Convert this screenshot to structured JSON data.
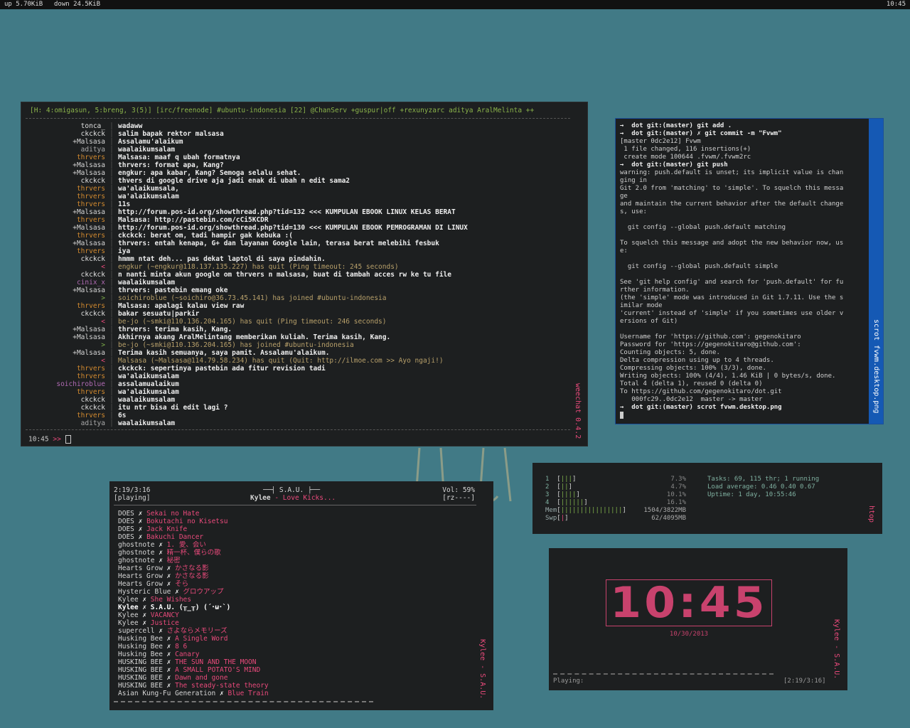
{
  "topbar": {
    "up": "up 5.70KiB",
    "down": "down 24.5KiB",
    "time": "10:45"
  },
  "weechat": {
    "title": "weechat 0.4.2",
    "topic": "[H: 4:omigasun, 5:breng, 3(5)] [irc/freenode] #ubuntu-indonesia [22] @ChanServ +guspur|off +rexunyzarc  aditya  AralMelinta ++",
    "lines": [
      {
        "nick": "tonca_",
        "nc": "#e0e0e0",
        "msg": "wadaww"
      },
      {
        "nick": "ckckck",
        "nc": "#e0e0e0",
        "msg": "salim bapak rektor malsasa"
      },
      {
        "nick": "+Malsasa",
        "nc": "#d6d6d6",
        "msg": "Assalamu'alaikum"
      },
      {
        "nick": "aditya",
        "nc": "#aaaaaa",
        "msg": "waalaikumsalam"
      },
      {
        "nick": "thrvers",
        "nc": "#d28a2f",
        "msg": "Malsasa: maaf q ubah formatnya"
      },
      {
        "nick": "+Malsasa",
        "nc": "#d6d6d6",
        "msg": "thrvers: format apa, Kang?"
      },
      {
        "nick": "+Malsasa",
        "nc": "#d6d6d6",
        "msg": "engkur: apa kabar, Kang? Semoga selalu sehat."
      },
      {
        "nick": "ckckck",
        "nc": "#e0e0e0",
        "msg": "thvers di google drive aja jadi enak di ubah n edit sama2"
      },
      {
        "nick": "thrvers",
        "nc": "#d28a2f",
        "msg": "wa'alaikumsala,"
      },
      {
        "nick": "thrvers",
        "nc": "#d28a2f",
        "msg": "wa'alaikumsalam"
      },
      {
        "nick": "thrvers",
        "nc": "#d28a2f",
        "msg": "11s"
      },
      {
        "nick": "+Malsasa",
        "nc": "#d6d6d6",
        "msg": "http://forum.pos-id.org/showthread.php?tid=132   <<<   KUMPULAN EBOOK LINUX KELAS BERAT"
      },
      {
        "nick": "thrvers",
        "nc": "#d28a2f",
        "msg": "Malsasa: http://pastebin.com/cCi5KCDR"
      },
      {
        "nick": "+Malsasa",
        "nc": "#d6d6d6",
        "msg": "http://forum.pos-id.org/showthread.php?tid=130   <<<   KUMPULAN EBOOK PEMROGRAMAN DI LINUX"
      },
      {
        "nick": "thrvers",
        "nc": "#d28a2f",
        "msg": "ckckck: berat om, tadi hampir gak kebuka :("
      },
      {
        "nick": "+Malsasa",
        "nc": "#d6d6d6",
        "msg": "thrvers: entah kenapa, G+ dan layanan Google lain, terasa berat melebihi fesbuk"
      },
      {
        "nick": "thrvers",
        "nc": "#d28a2f",
        "msg": "iya"
      },
      {
        "nick": "ckckck",
        "nc": "#e0e0e0",
        "msg": "hmmm ntat deh... pas dekat laptol di saya pindahin."
      },
      {
        "nick": "<",
        "nc": "#e94a7b",
        "msg": "engkur (~engkur@118.137.135.227) has quit (Ping timeout: 245 seconds)",
        "sys": "quit"
      },
      {
        "nick": "ckckck",
        "nc": "#e0e0e0",
        "msg": "n nanti minta akun google om thrvers n malsasa, buat di tambah acces rw ke tu file"
      },
      {
        "nick": "cinix_x",
        "nc": "#b06ab3",
        "msg": "waalaikumsalam"
      },
      {
        "nick": "+Malsasa",
        "nc": "#d6d6d6",
        "msg": "thrvers: pastebin emang oke"
      },
      {
        "nick": ">",
        "nc": "#7fb04a",
        "msg": "soichiroblue (~soichiro@36.73.45.141) has joined #ubuntu-indonesia",
        "sys": "join"
      },
      {
        "nick": "thrvers",
        "nc": "#d28a2f",
        "msg": "Malsasa: apalagi kalau view raw"
      },
      {
        "nick": "ckckck",
        "nc": "#e0e0e0",
        "msg": "bakar sesuatu|parkir"
      },
      {
        "nick": "<",
        "nc": "#e94a7b",
        "msg": "be-jo (~smki@110.136.204.165) has quit (Ping timeout: 246 seconds)",
        "sys": "quit"
      },
      {
        "nick": "+Malsasa",
        "nc": "#d6d6d6",
        "msg": "thrvers: terima kasih, Kang."
      },
      {
        "nick": "+Malsasa",
        "nc": "#d6d6d6",
        "msg": "Akhirnya akang AralMelintang memberikan kuliah. Terima kasih, Kang."
      },
      {
        "nick": ">",
        "nc": "#7fb04a",
        "msg": "be-jo (~smki@110.136.204.165) has joined #ubuntu-indonesia",
        "sys": "join"
      },
      {
        "nick": "+Malsasa",
        "nc": "#d6d6d6",
        "msg": "Terima kasih semuanya, saya pamit. Assalamu'alaikum."
      },
      {
        "nick": "<",
        "nc": "#e94a7b",
        "msg": "Malsasa (~Malsasa@114.79.58.234) has quit (Quit: http://ilmoe.com  >>  Ayo ngaji!)",
        "sys": "quit"
      },
      {
        "nick": "thrvers",
        "nc": "#d28a2f",
        "msg": "ckckck: sepertinya pastebin ada fitur revision tadi"
      },
      {
        "nick": "thrvers",
        "nc": "#d28a2f",
        "msg": "wa'alaikumsalam"
      },
      {
        "nick": "soichiroblue",
        "nc": "#b06ab3",
        "msg": "assalamualaikum"
      },
      {
        "nick": "thrvers",
        "nc": "#d28a2f",
        "msg": "wa'alaikumsalam"
      },
      {
        "nick": "ckckck",
        "nc": "#e0e0e0",
        "msg": "waalaikumsalam"
      },
      {
        "nick": "ckckck",
        "nc": "#e0e0e0",
        "msg": "itu ntr bisa di edit lagi ?"
      },
      {
        "nick": "thrvers",
        "nc": "#d28a2f",
        "msg": "6s"
      },
      {
        "nick": "aditya",
        "nc": "#aaaaaa",
        "msg": "waalaikumsalam"
      }
    ],
    "input_time": "10:45",
    "input_prompt": ">>"
  },
  "terminal": {
    "title": "scrot fvwm.desktop.png",
    "lines": [
      {
        "t": "→  dot git:(master) git add .",
        "p": true
      },
      {
        "t": "→  dot git:(master) ✗ git commit -m \"Fvwm\"",
        "p": true
      },
      {
        "t": "[master 0dc2e12] Fvwm"
      },
      {
        "t": " 1 file changed, 116 insertions(+)"
      },
      {
        "t": " create mode 100644 .fvwm/.fvwm2rc"
      },
      {
        "t": "→  dot git:(master) git push",
        "p": true
      },
      {
        "t": "warning: push.default is unset; its implicit value is chan"
      },
      {
        "t": "ging in"
      },
      {
        "t": "Git 2.0 from 'matching' to 'simple'. To squelch this messa"
      },
      {
        "t": "ge"
      },
      {
        "t": "and maintain the current behavior after the default change"
      },
      {
        "t": "s, use:"
      },
      {
        "t": ""
      },
      {
        "t": "  git config --global push.default matching"
      },
      {
        "t": ""
      },
      {
        "t": "To squelch this message and adopt the new behavior now, us"
      },
      {
        "t": "e:"
      },
      {
        "t": ""
      },
      {
        "t": "  git config --global push.default simple"
      },
      {
        "t": ""
      },
      {
        "t": "See 'git help config' and search for 'push.default' for fu"
      },
      {
        "t": "rther information."
      },
      {
        "t": "(the 'simple' mode was introduced in Git 1.7.11. Use the s"
      },
      {
        "t": "imilar mode"
      },
      {
        "t": "'current' instead of 'simple' if you sometimes use older v"
      },
      {
        "t": "ersions of Git)"
      },
      {
        "t": ""
      },
      {
        "t": "Username for 'https://github.com': gegenokitaro"
      },
      {
        "t": "Password for 'https://gegenokitaro@github.com':"
      },
      {
        "t": "Counting objects: 5, done."
      },
      {
        "t": "Delta compression using up to 4 threads."
      },
      {
        "t": "Compressing objects: 100% (3/3), done."
      },
      {
        "t": "Writing objects: 100% (4/4), 1.46 KiB | 0 bytes/s, done."
      },
      {
        "t": "Total 4 (delta 1), reused 0 (delta 0)"
      },
      {
        "t": "To https://github.com/gegenokitaro/dot.git"
      },
      {
        "t": "   000fc29..0dc2e12  master -> master"
      },
      {
        "t": "→  dot git:(master) scrot fvwm.desktop.png",
        "p": true
      }
    ]
  },
  "music": {
    "title": "Kylee - S.A.U.",
    "time": "2:19/3:16",
    "album": "S.A.U.",
    "vol": "Vol: 59%",
    "state": "[playing]",
    "artist": "Kylee",
    "song": "Love Kicks...",
    "flags": "[rz----]",
    "playlist": [
      {
        "a": "DOES",
        "s": "Sekai no Hate"
      },
      {
        "a": "DOES",
        "s": "Bokutachi no Kisetsu"
      },
      {
        "a": "DOES",
        "s": "Jack Knife"
      },
      {
        "a": "DOES",
        "s": "Bakuchi Dancer"
      },
      {
        "a": "ghostnote",
        "s": "1. 愛、会い"
      },
      {
        "a": "ghostnote",
        "s": "精一杯、僕らの歌"
      },
      {
        "a": "ghostnote",
        "s": "秘密"
      },
      {
        "a": "Hearts Grow",
        "s": "かさなる影"
      },
      {
        "a": "Hearts Grow",
        "s": "かさなる影"
      },
      {
        "a": "Hearts Grow",
        "s": "そら"
      },
      {
        "a": "Hysteric Blue",
        "s": "グロウアップ"
      },
      {
        "a": "Kylee",
        "s": "She Wishes"
      },
      {
        "a": "Kylee",
        "s": "S.A.U. (╥_╥) (´･ω･`)",
        "cur": true
      },
      {
        "a": "Kylee",
        "s": "VACANCY"
      },
      {
        "a": "Kylee",
        "s": "Justice"
      },
      {
        "a": "supercell",
        "s": "さよならメモリーズ"
      },
      {
        "a": "Husking Bee",
        "s": "A Single Word"
      },
      {
        "a": "Husking Bee",
        "s": "8 6"
      },
      {
        "a": "Husking Bee",
        "s": "Canary"
      },
      {
        "a": "HUSKING BEE",
        "s": "THE SUN AND THE MOON"
      },
      {
        "a": "HUSKING BEE",
        "s": "A SMALL POTATO'S MIND"
      },
      {
        "a": "HUSKING BEE",
        "s": "Dawn and gone"
      },
      {
        "a": "HUSKING BEE",
        "s": "The steady-state theory"
      },
      {
        "a": "Asian Kung-Fu Generation",
        "s": "Blue Train"
      }
    ]
  },
  "htop": {
    "title": "htop",
    "cpus": [
      {
        "id": "1",
        "bar": "|||",
        "pct": "7.3%"
      },
      {
        "id": "2",
        "bar": "||",
        "pct": "4.7%"
      },
      {
        "id": "3",
        "bar": "||||",
        "pct": "10.1%"
      },
      {
        "id": "4",
        "bar": "||||||",
        "pct": "16.1%"
      }
    ],
    "mem": {
      "bar": "||||||||||||||||",
      "val": "1504/3822MB"
    },
    "swp": {
      "bar": "|",
      "val": "62/4095MB"
    },
    "tasks": "Tasks: 69, 115 thr; 1 running",
    "load": "Load average: 0.46 0.40 0.67",
    "uptime": "Uptime: 1 day, 10:55:46"
  },
  "clock": {
    "title": "Kylee - S.A.U.",
    "time": "10:45",
    "date": "10/30/2013",
    "status": "Playing:",
    "pos": "[2:19/3:16]"
  }
}
